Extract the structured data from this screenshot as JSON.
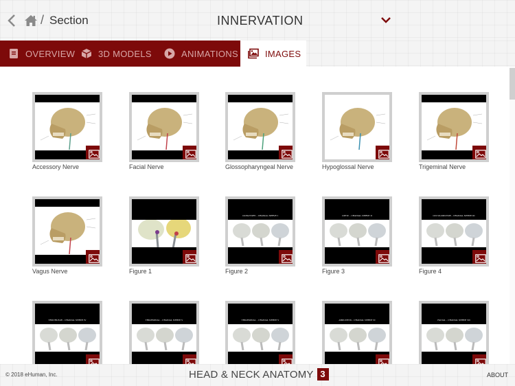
{
  "header": {
    "breadcrumb_section": "Section",
    "breadcrumb_separator": "/",
    "title": "INNERVATION",
    "icons": {
      "back": "chevron-left-icon",
      "home": "home-icon",
      "dropdown": "chevron-down-icon"
    }
  },
  "tabs": [
    {
      "label": "OVERVIEW",
      "icon": "book-icon",
      "active": false
    },
    {
      "label": "3D MODELS",
      "icon": "cube-icon",
      "active": false
    },
    {
      "label": "ANIMATIONS",
      "icon": "play-circle-icon",
      "active": false
    },
    {
      "label": "IMAGES",
      "icon": "images-icon",
      "active": true
    }
  ],
  "images": [
    {
      "label": "Accessory Nerve",
      "style": "skull"
    },
    {
      "label": "Facial Nerve",
      "style": "skull"
    },
    {
      "label": "Glossopharyngeal Nerve",
      "style": "skull"
    },
    {
      "label": "Hypoglossal Nerve",
      "style": "skull-nobars"
    },
    {
      "label": "Trigeminal Nerve",
      "style": "skull"
    },
    {
      "label": "Vagus Nerve",
      "style": "skull"
    },
    {
      "label": "Figure 1",
      "style": "brain"
    },
    {
      "label": "Figure 2",
      "style": "fig",
      "caption": "OLFACTORY – CRANIAL NERVE I"
    },
    {
      "label": "Figure 3",
      "style": "fig",
      "caption": "OPTIC – CRANIAL NERVE II"
    },
    {
      "label": "Figure 4",
      "style": "fig",
      "caption": "OCCULOMOTOR – CRANIAL NERVE III"
    },
    {
      "label": "",
      "style": "fig",
      "caption": "TROCHLEAR – CRANIAL NERVE IV"
    },
    {
      "label": "",
      "style": "fig",
      "caption": "TRIGEMINAL – CRANIAL NERVE V"
    },
    {
      "label": "",
      "style": "fig",
      "caption": "TRIGEMINAL – CRANIAL NERVE V"
    },
    {
      "label": "",
      "style": "fig",
      "caption": "ABDUCENS – CRANIAL NERVE VI"
    },
    {
      "label": "",
      "style": "fig",
      "caption": "FACIAL – CRANIAL NERVE VII"
    }
  ],
  "footer": {
    "copyright": "© 2018 eHuman, Inc.",
    "brand": "HEAD & NECK ANATOMY",
    "brand_number": "3",
    "about": "ABOUT"
  },
  "colors": {
    "accent": "#7d0a0a",
    "tab_inactive_text": "#d8a7a7",
    "thumb_border": "#cfcfcf"
  }
}
